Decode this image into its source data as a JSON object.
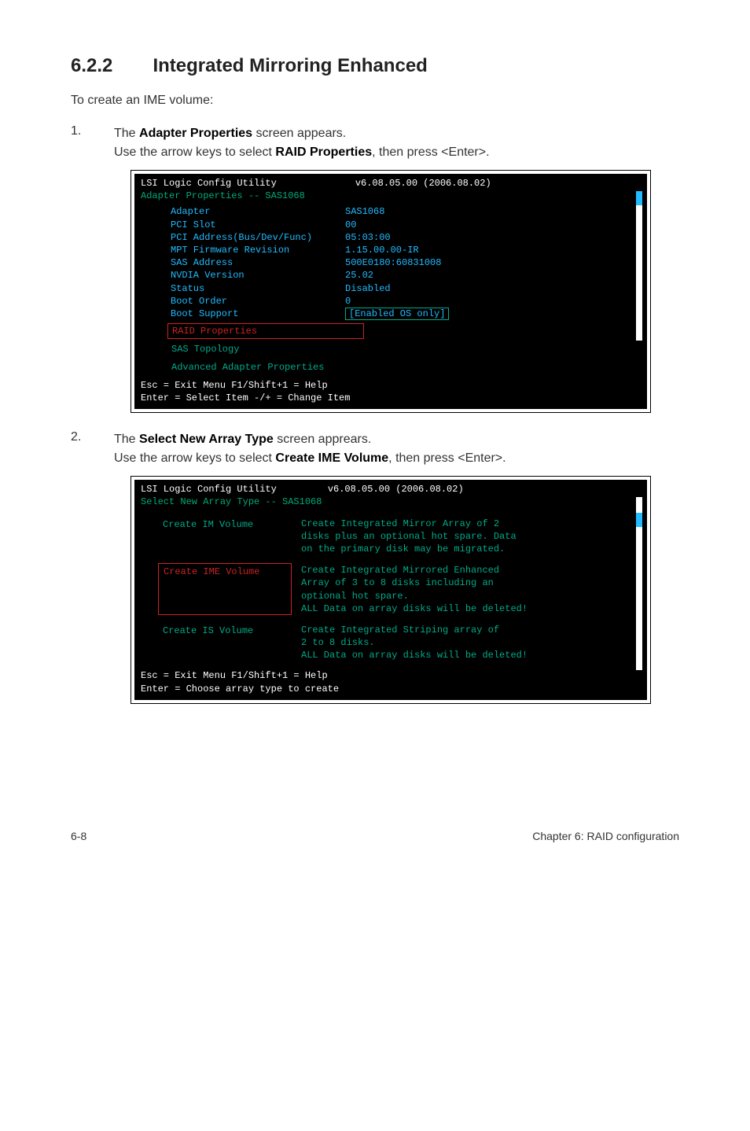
{
  "section": {
    "number": "6.2.2",
    "title": "Integrated Mirroring Enhanced"
  },
  "intro": "To create an IME volume:",
  "steps": {
    "s1": {
      "num": "1.",
      "line1a": "The ",
      "line1b": "Adapter Properties",
      "line1c": " screen appears.",
      "line2a": "Use the arrow keys to select ",
      "line2b": "RAID Properties",
      "line2c": ", then press <Enter>."
    },
    "s2": {
      "num": "2.",
      "line1a": "The ",
      "line1b": "Select New Array Type",
      "line1c": " screen apprears.",
      "line2a": "Use the arrow keys to select ",
      "line2b": "Create IME Volume",
      "line2c": ", then press <Enter>."
    }
  },
  "bios1": {
    "title": "LSI Logic Config Utility",
    "version": "v6.08.05.00 (2006.08.02)",
    "subtitle": "Adapter Properties -- SAS1068",
    "rows": [
      {
        "label": "Adapter",
        "value": "SAS1068"
      },
      {
        "label": "PCI Slot",
        "value": "00"
      },
      {
        "label": "PCI Address(Bus/Dev/Func)",
        "value": "05:03:00"
      },
      {
        "label": "MPT Firmware Revision",
        "value": "1.15.00.00-IR"
      },
      {
        "label": "SAS Address",
        "value": "500E0180:60831008"
      },
      {
        "label": "NVDIA Version",
        "value": "25.02"
      },
      {
        "label": "Status",
        "value": "Disabled"
      },
      {
        "label": "Boot Order",
        "value": "0"
      },
      {
        "label": "Boot Support",
        "value": "[Enabled OS only]",
        "boxed": true
      }
    ],
    "menu": [
      "RAID Properties",
      "SAS Topology",
      "Advanced Adapter Properties"
    ],
    "footer1": "Esc = Exit Menu     F1/Shift+1 = Help",
    "footer2": "Enter = Select Item  -/+ = Change Item"
  },
  "bios2": {
    "title": "LSI Logic Config Utility",
    "version": "v6.08.05.00 (2006.08.02)",
    "subtitle": "Select New Array Type -- SAS1068",
    "opts": [
      {
        "label": "Create IM Volume",
        "style": "teal",
        "desc": "Create Integrated Mirror Array of 2\ndisks plus an optional hot spare. Data\non the primary disk may be migrated."
      },
      {
        "label": "Create IME Volume",
        "style": "red",
        "desc": "Create Integrated Mirrored Enhanced\nArray of 3 to 8 disks including an\noptional hot spare.\nALL Data on array disks will be deleted!"
      },
      {
        "label": "Create IS Volume",
        "style": "teal",
        "desc": "Create Integrated Striping array of\n2 to 8 disks.\nALL Data on array disks will be deleted!"
      }
    ],
    "footer1": "Esc = Exit Menu     F1/Shift+1 = Help",
    "footer2": "Enter = Choose array type to create"
  },
  "footer": {
    "left": "6-8",
    "right": "Chapter 6: RAID configuration"
  }
}
